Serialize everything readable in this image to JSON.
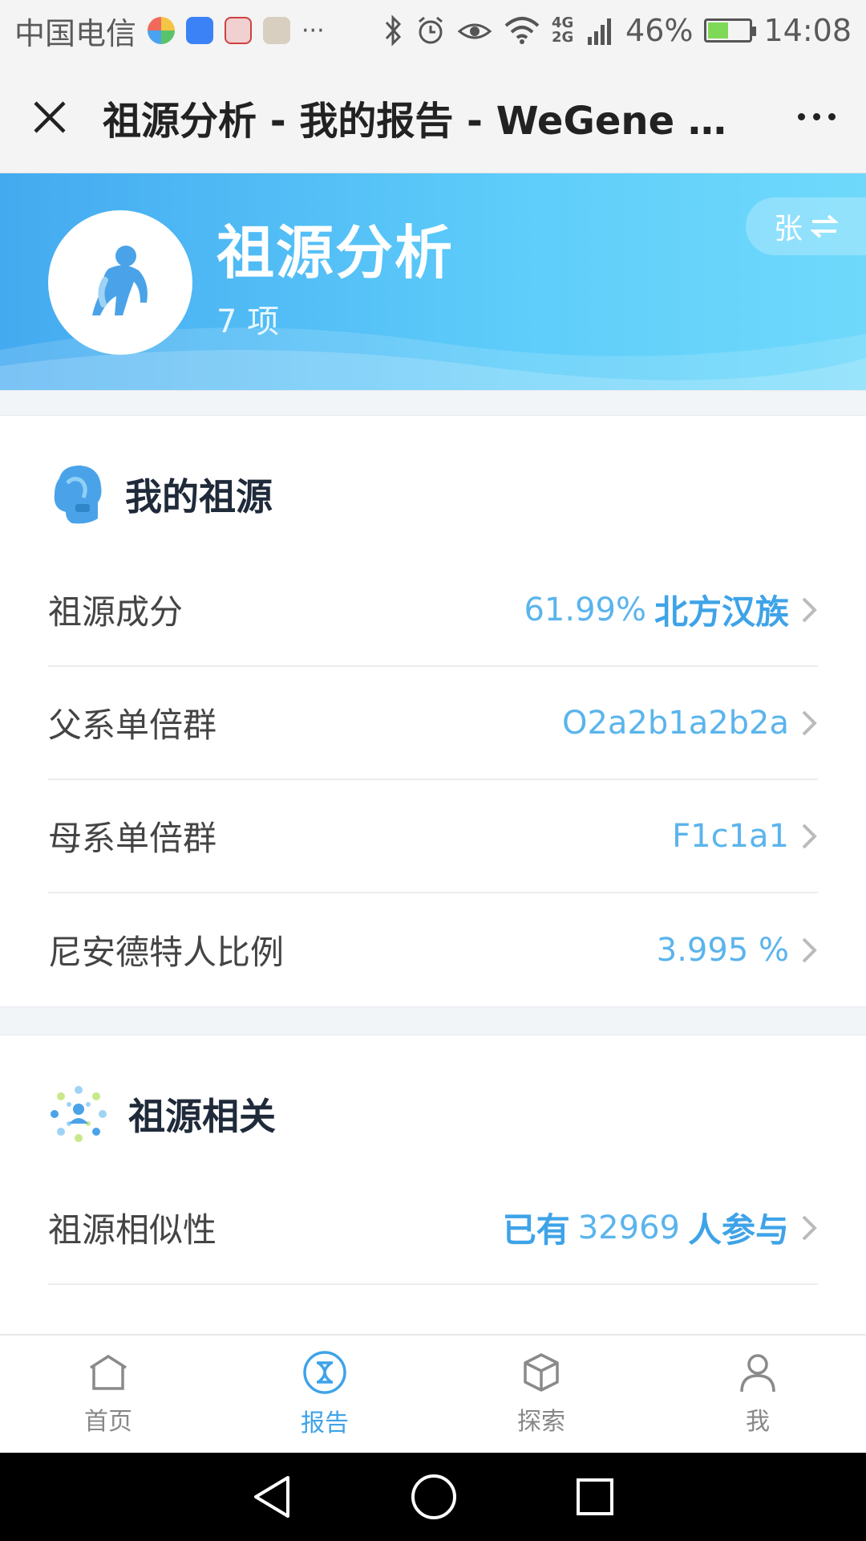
{
  "status_bar": {
    "carrier": "中国电信",
    "signal_type": "4G 2G",
    "battery": "46%",
    "battery_level": 0.46,
    "time": "14:08",
    "dots": "···"
  },
  "title_bar": {
    "title": "祖源分析 - 我的报告 - WeGene 微…"
  },
  "banner": {
    "title": "祖源分析",
    "count": "7 项",
    "switch_label": "张",
    "colors": {
      "start": "#44aaf0",
      "end": "#6fd9fb"
    }
  },
  "section_ancestry": {
    "heading": "我的祖源",
    "rows": [
      {
        "label": "祖源成分",
        "value_num": "61.99%",
        "value_strong": "北方汉族"
      },
      {
        "label": "父系单倍群",
        "value_num": "O2a2b1a2b2a"
      },
      {
        "label": "母系单倍群",
        "value_num": "F1c1a1"
      },
      {
        "label": "尼安德特人比例",
        "value_num": "3.995 %"
      }
    ]
  },
  "section_related": {
    "heading": "祖源相关",
    "rows": [
      {
        "label": "祖源相似性",
        "prefix": "已有",
        "value_num": "32969",
        "suffix": "人参与"
      }
    ]
  },
  "tabbar": {
    "tabs": [
      {
        "label": "首页",
        "icon": "home-icon"
      },
      {
        "label": "报告",
        "icon": "report-icon",
        "active": true
      },
      {
        "label": "探索",
        "icon": "explore-cube-icon"
      },
      {
        "label": "我",
        "icon": "person-icon"
      }
    ]
  },
  "accent_color": "#3ea3e8"
}
